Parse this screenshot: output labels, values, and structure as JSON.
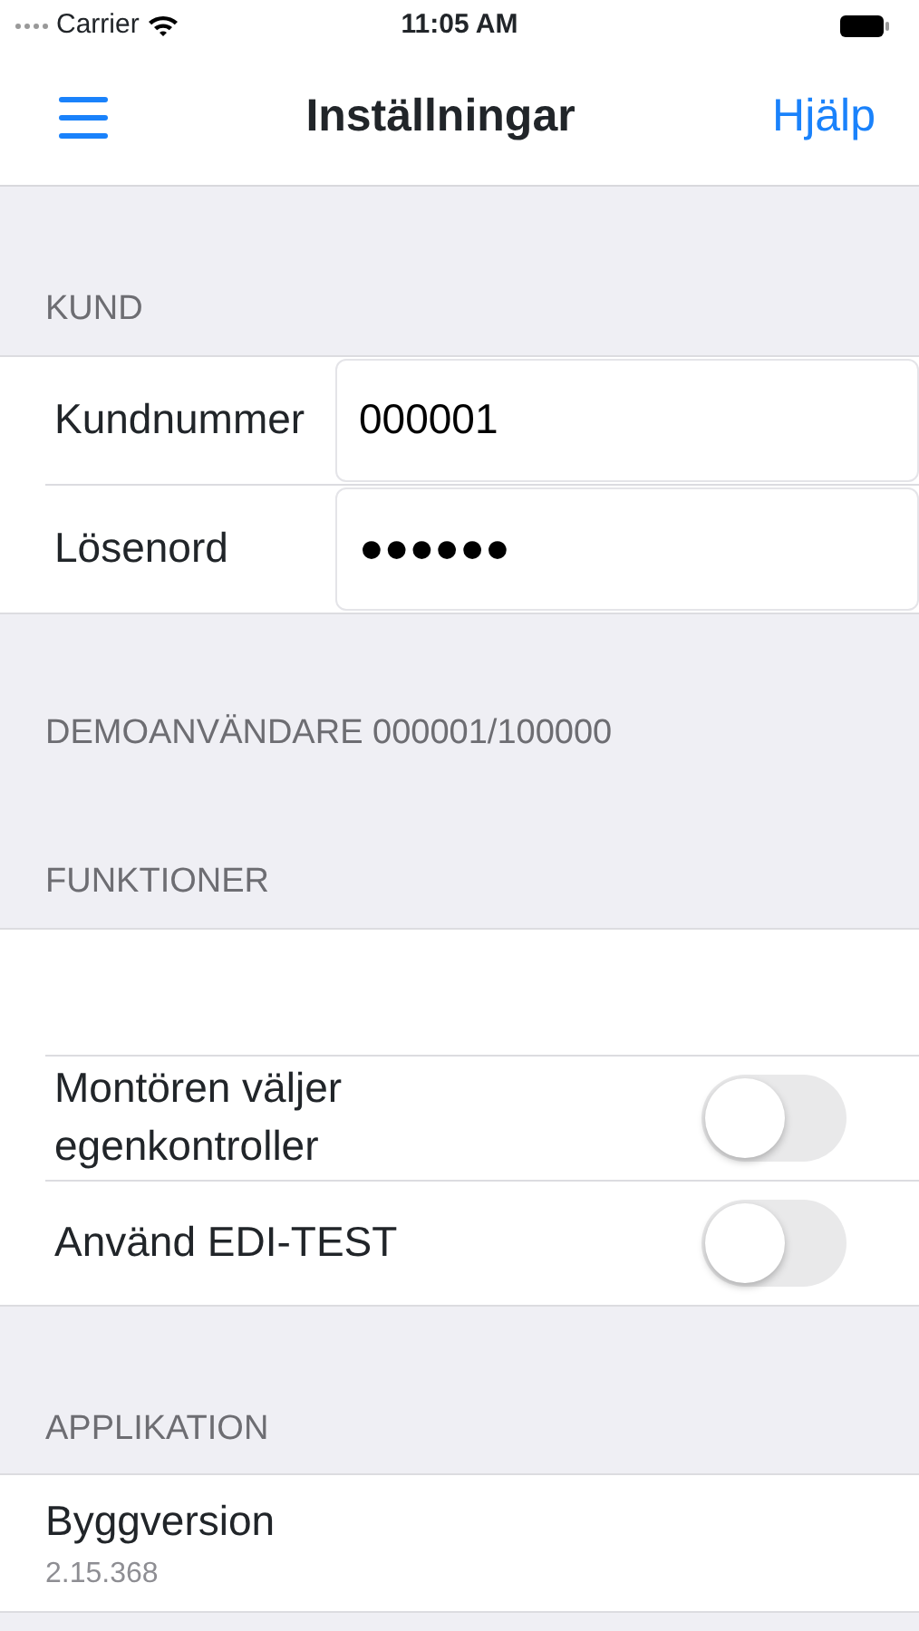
{
  "status_bar": {
    "carrier": "Carrier",
    "time": "11:05 AM"
  },
  "nav": {
    "title": "Inställningar",
    "right_button": "Hjälp"
  },
  "sections": [
    {
      "header": "KUND",
      "rows": [
        {
          "kind": "field",
          "label": "Kundnummer",
          "value": "000001"
        },
        {
          "kind": "field",
          "label": "Lösenord",
          "value": "●●●●●●"
        }
      ],
      "footer": "DEMOANVÄNDARE 000001/100000"
    },
    {
      "header": "FUNKTIONER",
      "rows": [
        {
          "kind": "blank"
        },
        {
          "kind": "switch",
          "label": "Montören väljer egenkontroller",
          "on": false
        },
        {
          "kind": "switch",
          "label": "Använd EDI-TEST",
          "on": false
        }
      ]
    },
    {
      "header": "APPLIKATION",
      "rows": [
        {
          "kind": "detail",
          "label": "Byggversion",
          "detail": "2.15.368"
        }
      ]
    }
  ]
}
